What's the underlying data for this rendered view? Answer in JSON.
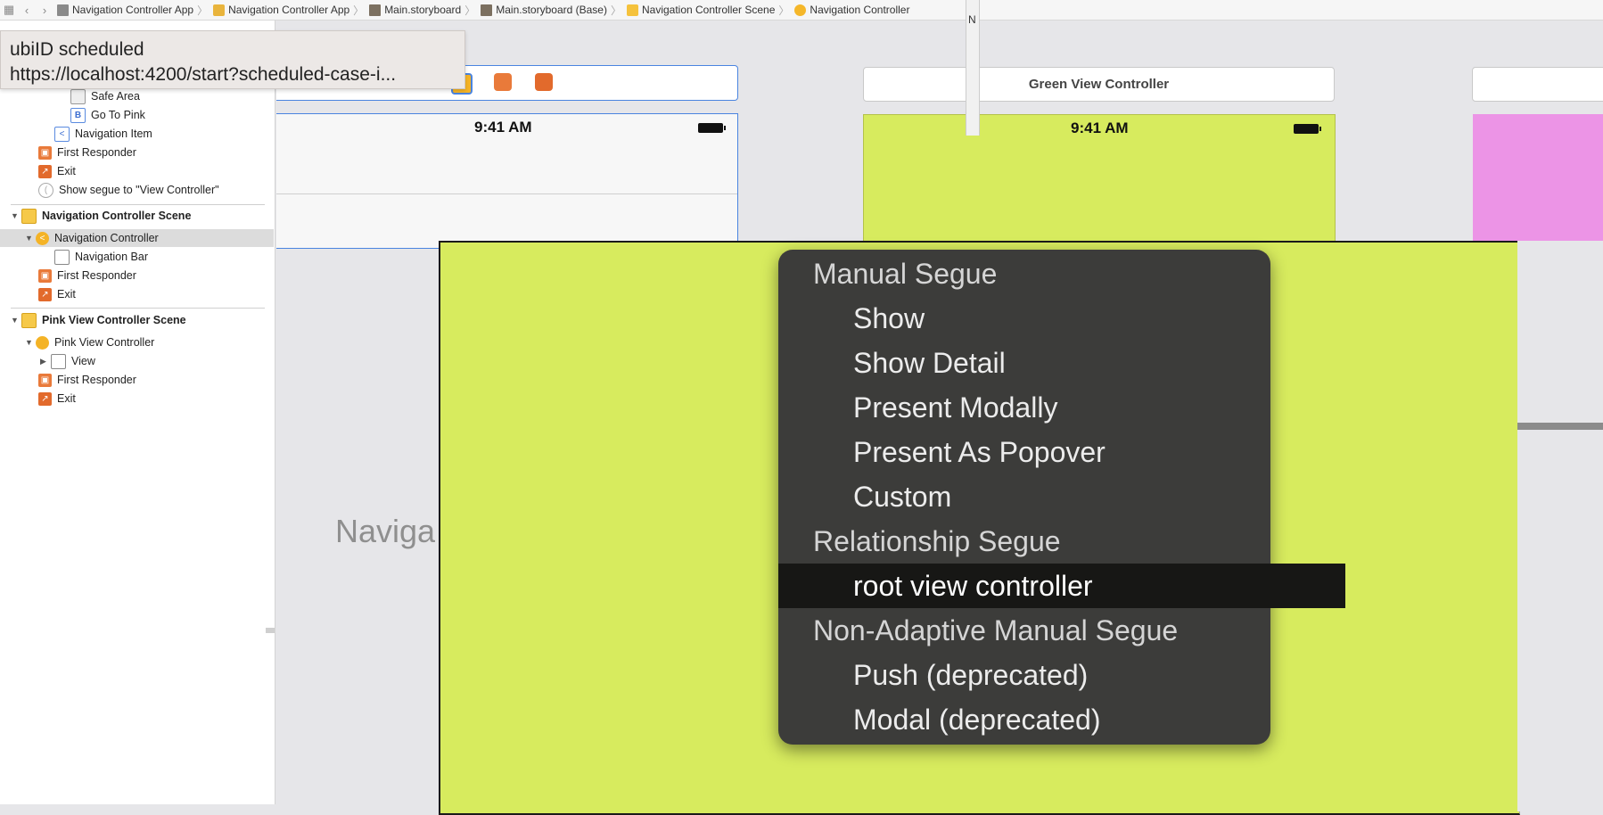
{
  "jumpbar": {
    "crumbs": [
      {
        "label": "Navigation Controller App",
        "icon": "project-file-icon"
      },
      {
        "label": "Navigation Controller App",
        "icon": "folder-icon"
      },
      {
        "label": "Main.storyboard",
        "icon": "storyboard-file-icon"
      },
      {
        "label": "Main.storyboard (Base)",
        "icon": "storyboard-file-icon"
      },
      {
        "label": "Navigation Controller Scene",
        "icon": "scene-icon"
      },
      {
        "label": "Navigation Controller",
        "icon": "navigation-controller-icon"
      }
    ]
  },
  "tooltip": {
    "line1": "ubiID scheduled",
    "line2": "https://localhost:4200/start?scheduled-case-i..."
  },
  "outline": {
    "rows": [
      {
        "label": "Safe Area",
        "icon": "safe-area-icon"
      },
      {
        "label": "Go To Pink",
        "icon": "button-icon",
        "glyph": "B"
      },
      {
        "label": "Navigation Item",
        "icon": "navigation-item-icon",
        "glyph": "<"
      },
      {
        "label": "First Responder",
        "icon": "first-responder-icon"
      },
      {
        "label": "Exit",
        "icon": "exit-icon"
      },
      {
        "label": "Show segue to \"View Controller\"",
        "icon": "segue-icon"
      }
    ],
    "nav_scene": {
      "title": "Navigation Controller Scene",
      "controller": "Navigation Controller",
      "bar": "Navigation Bar",
      "responder": "First Responder",
      "exit": "Exit"
    },
    "pink_scene": {
      "title": "Pink View Controller Scene",
      "controller": "Pink View Controller",
      "view": "View",
      "responder": "First Responder",
      "exit": "Exit"
    }
  },
  "canvas": {
    "left_time": "9:41 AM",
    "green_title": "Green View Controller",
    "green_time": "9:41 AM",
    "nav_label": "Naviga",
    "pin_text": "N",
    "scene_green_color": "#d7eb5e",
    "scene_pink_color": "#ec94e6"
  },
  "segue_menu": {
    "items": [
      {
        "label": "Manual Segue",
        "kind": "header"
      },
      {
        "label": "Show",
        "kind": "option"
      },
      {
        "label": "Show Detail",
        "kind": "option"
      },
      {
        "label": "Present Modally",
        "kind": "option"
      },
      {
        "label": "Present As Popover",
        "kind": "option"
      },
      {
        "label": "Custom",
        "kind": "option"
      },
      {
        "label": "Relationship Segue",
        "kind": "header"
      },
      {
        "label": "root view controller",
        "kind": "option",
        "highlighted": true
      },
      {
        "label": "Non-Adaptive Manual Segue",
        "kind": "header"
      },
      {
        "label": "Push (deprecated)",
        "kind": "option"
      },
      {
        "label": "Modal (deprecated)",
        "kind": "option"
      }
    ]
  }
}
